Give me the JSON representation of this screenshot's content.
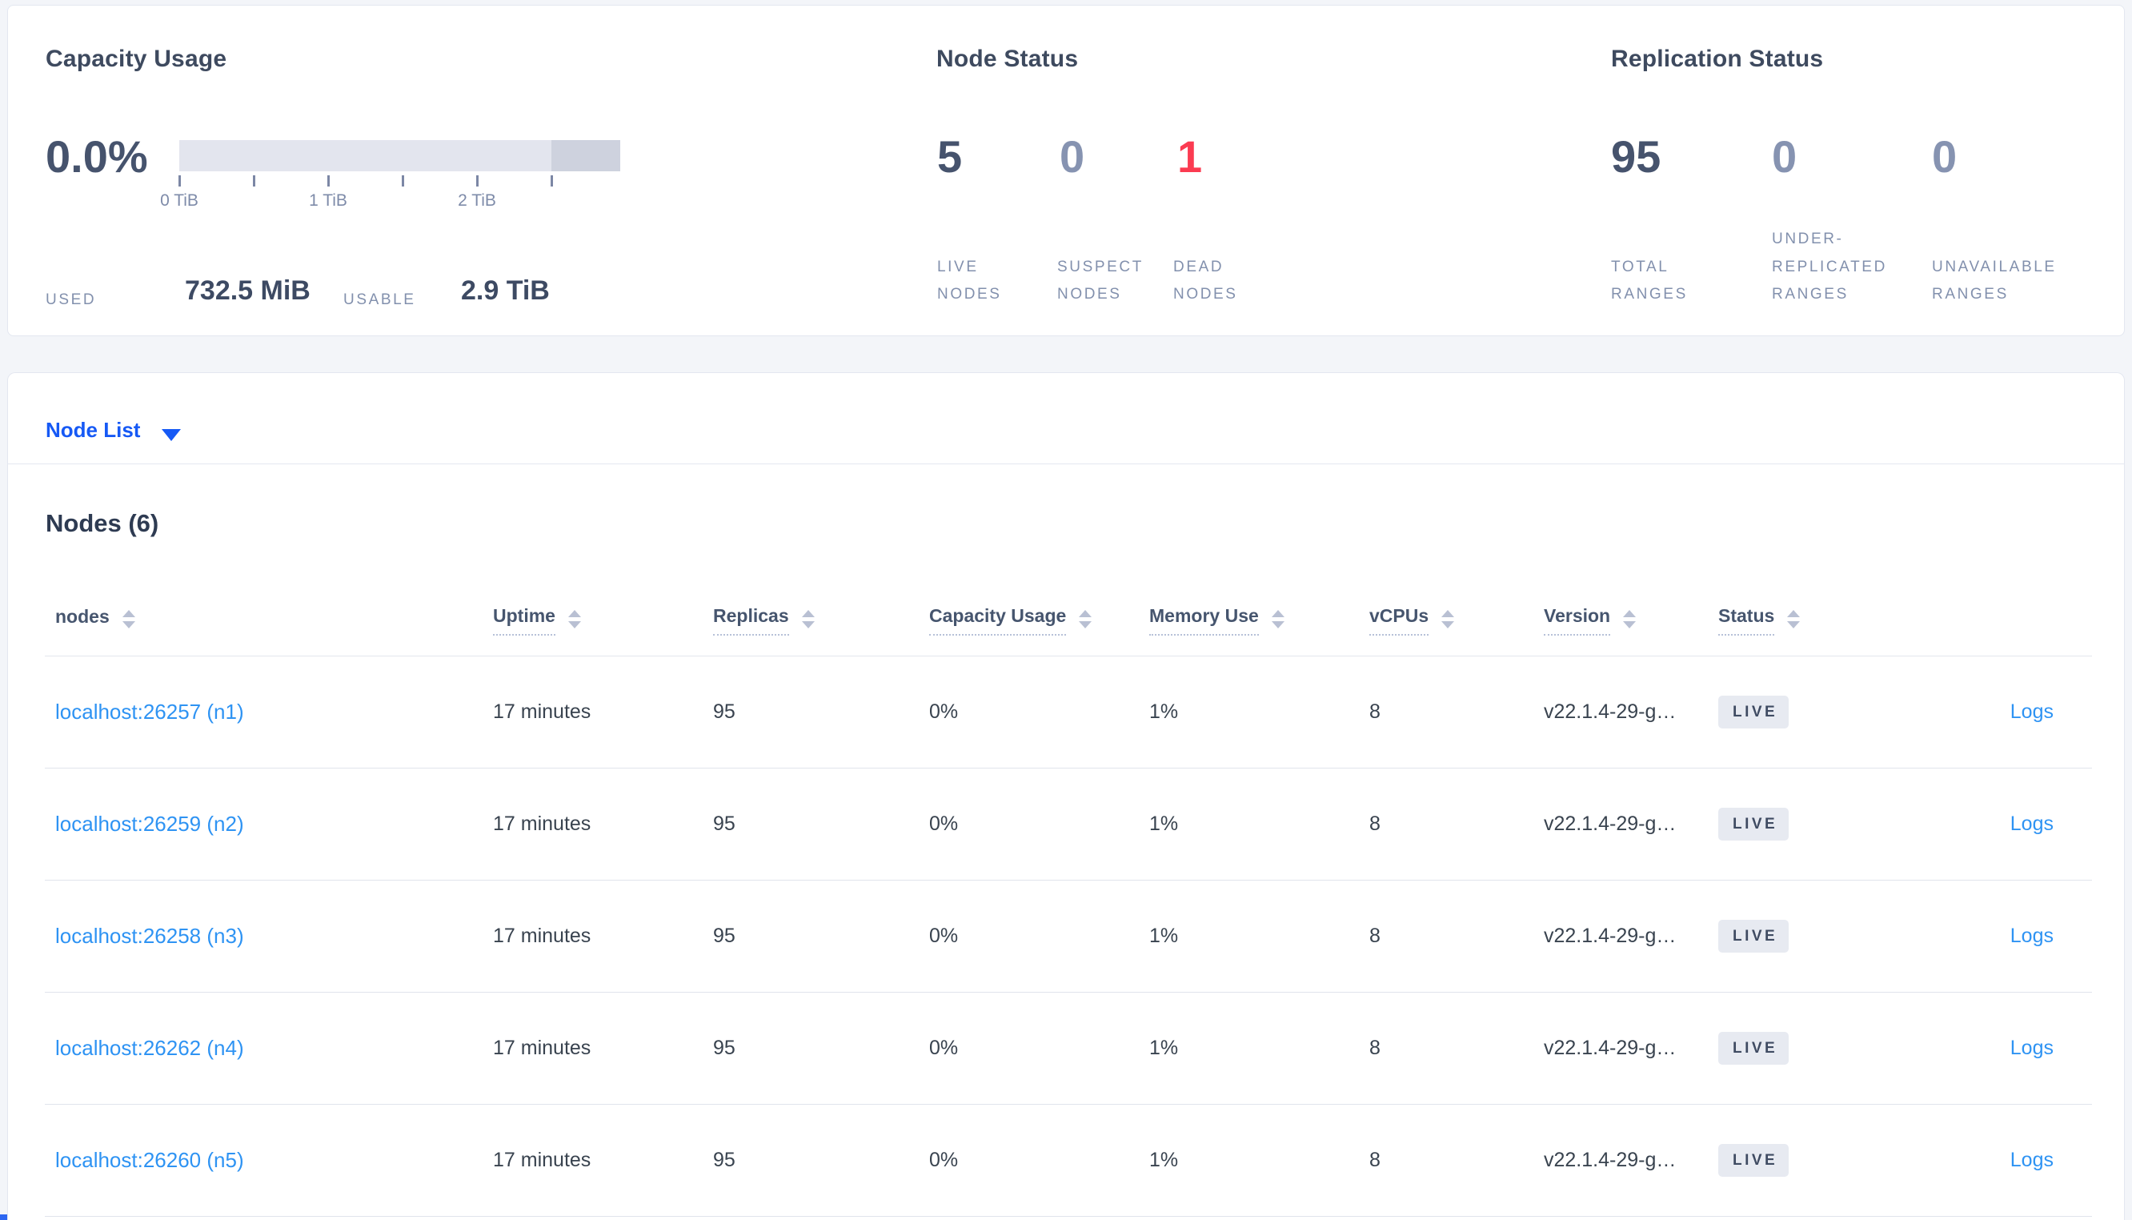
{
  "capacity_panel": {
    "title": "Capacity Usage",
    "percent": "0.0%",
    "tick_labels": [
      "0 TiB",
      "1 TiB",
      "2 TiB"
    ],
    "used_label": "USED",
    "used_value": "732.5 MiB",
    "usable_label": "USABLE",
    "usable_value": "2.9 TiB"
  },
  "node_status_panel": {
    "title": "Node Status",
    "live": {
      "value": "5",
      "label": "LIVE NODES"
    },
    "suspect": {
      "value": "0",
      "label": "SUSPECT NODES"
    },
    "dead": {
      "value": "1",
      "label": "DEAD NODES"
    }
  },
  "replication_panel": {
    "title": "Replication Status",
    "total": {
      "value": "95",
      "label": "TOTAL RANGES"
    },
    "under_replicated": {
      "value": "0",
      "label": "UNDER-REPLICATED RANGES"
    },
    "unavailable": {
      "value": "0",
      "label": "UNAVAILABLE RANGES"
    }
  },
  "node_list": {
    "dropdown_label": "Node List",
    "heading": "Nodes (6)",
    "columns": [
      "nodes",
      "Uptime",
      "Replicas",
      "Capacity Usage",
      "Memory Use",
      "vCPUs",
      "Version",
      "Status"
    ],
    "logs_label": "Logs",
    "rows": [
      {
        "node": "localhost:26257 (n1)",
        "uptime": "17 minutes",
        "replicas": "95",
        "capacity_usage": "0%",
        "memory_use": "1%",
        "vcpus": "8",
        "version": "v22.1.4-29-g…",
        "status": "LIVE"
      },
      {
        "node": "localhost:26259 (n2)",
        "uptime": "17 minutes",
        "replicas": "95",
        "capacity_usage": "0%",
        "memory_use": "1%",
        "vcpus": "8",
        "version": "v22.1.4-29-g…",
        "status": "LIVE"
      },
      {
        "node": "localhost:26258 (n3)",
        "uptime": "17 minutes",
        "replicas": "95",
        "capacity_usage": "0%",
        "memory_use": "1%",
        "vcpus": "8",
        "version": "v22.1.4-29-g…",
        "status": "LIVE"
      },
      {
        "node": "localhost:26262 (n4)",
        "uptime": "17 minutes",
        "replicas": "95",
        "capacity_usage": "0%",
        "memory_use": "1%",
        "vcpus": "8",
        "version": "v22.1.4-29-g…",
        "status": "LIVE"
      },
      {
        "node": "localhost:26260 (n5)",
        "uptime": "17 minutes",
        "replicas": "95",
        "capacity_usage": "0%",
        "memory_use": "1%",
        "vcpus": "8",
        "version": "v22.1.4-29-g…",
        "status": "LIVE"
      }
    ]
  },
  "icons": {
    "dropdown_caret": "caret-down-icon",
    "column_sort": "sort-arrows-icon"
  },
  "colors": {
    "accent_blue": "#1659f5",
    "link_blue": "#2e93f3",
    "danger_red": "#fb3b51",
    "dark_slate": "#46536d",
    "muted_slate": "#8693b1",
    "label_gray": "#8290ad",
    "badge_bg": "#e7eaf1",
    "bar_light": "#e3e5ee",
    "bar_dark": "#ced2de",
    "page_bg": "#f3f5f9"
  }
}
